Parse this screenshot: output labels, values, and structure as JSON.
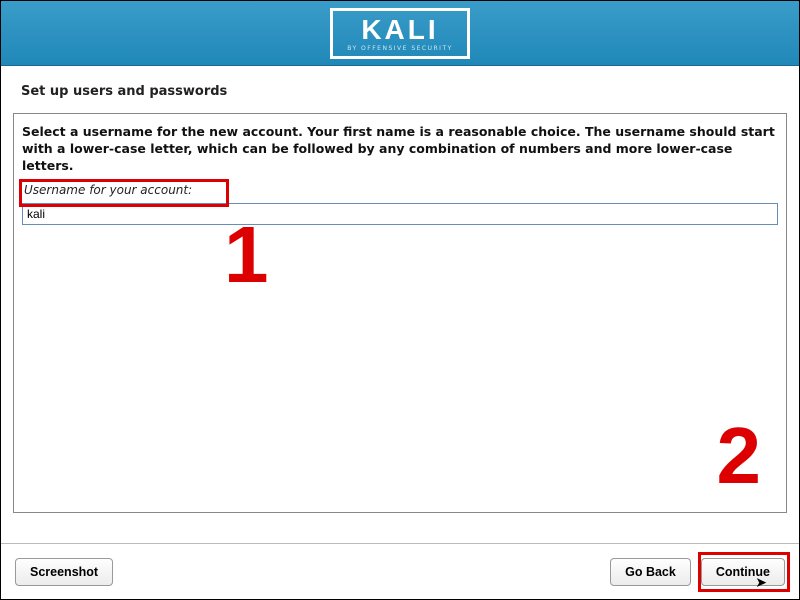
{
  "header": {
    "logo_text": "KALI",
    "logo_sub": "BY OFFENSIVE SECURITY"
  },
  "page": {
    "title": "Set up users and passwords",
    "instruction": "Select a username for the new account. Your first name is a reasonable choice. The username should start with a lower-case letter, which can be followed by any combination of numbers and more lower-case letters.",
    "field_label": "Username for your account:",
    "username_value": "kali"
  },
  "annotations": {
    "one": "1",
    "two": "2"
  },
  "buttons": {
    "screenshot": "Screenshot",
    "go_back": "Go Back",
    "continue": "Continue"
  }
}
